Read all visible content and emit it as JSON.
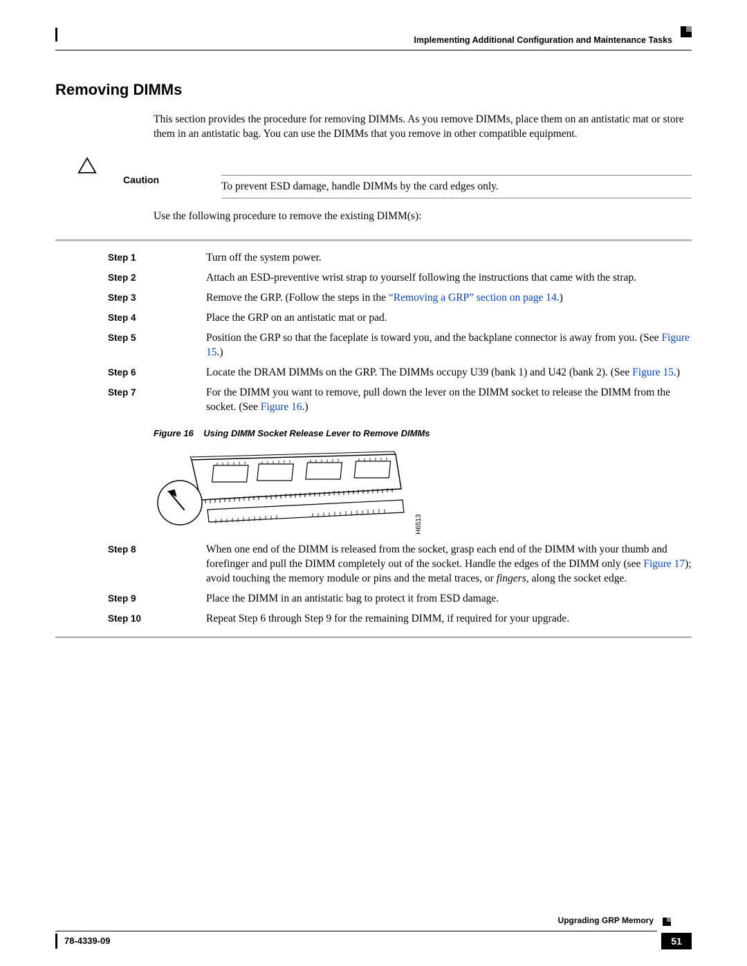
{
  "header": {
    "chapter": "Implementing Additional Configuration and Maintenance Tasks"
  },
  "section": {
    "title": "Removing DIMMs"
  },
  "intro": "This section provides the procedure for removing DIMMs. As you remove DIMMs, place them on an antistatic mat or store them in an antistatic bag. You can use the DIMMs that you remove in other compatible equipment.",
  "caution": {
    "label": "Caution",
    "text": "To prevent ESD damage, handle DIMMs by the card edges only."
  },
  "lead_in": "Use the following procedure to remove the existing DIMM(s):",
  "steps": [
    {
      "n": "Step 1",
      "t1": "Turn off the system power."
    },
    {
      "n": "Step 2",
      "t1": "Attach an ESD-preventive wrist strap to yourself following the instructions that came with the strap."
    },
    {
      "n": "Step 3",
      "t1": "Remove the GRP. (Follow the steps in the ",
      "link": "“Removing a GRP” section on page 14",
      "t2": ".)"
    },
    {
      "n": "Step 4",
      "t1": "Place the GRP on an antistatic mat or pad."
    },
    {
      "n": "Step 5",
      "t1": "Position the GRP so that the faceplate is toward you, and the backplane connector is away from you. (See ",
      "link": "Figure 15",
      "t2": ".)"
    },
    {
      "n": "Step 6",
      "t1": "Locate the DRAM DIMMs on the GRP. The DIMMs occupy U39 (bank 1) and U42 (bank 2). (See ",
      "link": "Figure 15",
      "t2": ".)"
    },
    {
      "n": "Step 7",
      "t1": "For the DIMM you want to remove, pull down the lever on the DIMM socket to release the DIMM from the socket. (See ",
      "link": "Figure 16",
      "t2": ".)"
    }
  ],
  "figure": {
    "label": "Figure 16",
    "title": "Using DIMM Socket Release Lever to Remove DIMMs",
    "id": "H6513"
  },
  "steps2": [
    {
      "n": "Step 8",
      "t1": "When one end of the DIMM is released from the socket, grasp each end of the DIMM with your thumb and forefinger and pull the DIMM completely out of the socket. Handle the edges of the DIMM only (see ",
      "link": "Figure 17",
      "t2": "); avoid touching the memory module or pins and the metal traces, or ",
      "ital": "fingers",
      "t3": ", along the socket edge."
    },
    {
      "n": "Step 9",
      "t1": "Place the DIMM in an antistatic bag to protect it from ESD damage."
    },
    {
      "n": "Step 10",
      "t1": "Repeat Step 6 through Step 9 for the remaining DIMM, if required for your upgrade."
    }
  ],
  "footer": {
    "section": "Upgrading GRP Memory",
    "doc": "78-4339-09",
    "page": "51"
  }
}
